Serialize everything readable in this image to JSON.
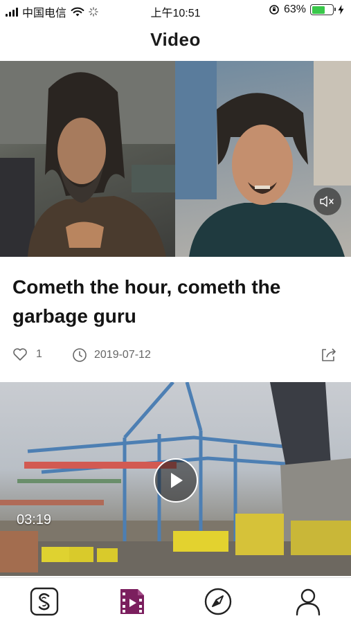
{
  "status_bar": {
    "carrier": "中国电信",
    "time": "上午10:51",
    "battery_percent": "63%",
    "battery_level": 0.63,
    "battery_color": "#39c84a"
  },
  "header": {
    "title": "Video"
  },
  "hero": {
    "headline": "Cometh the hour, cometh the garbage guru",
    "mute_icon": "speaker-muted-icon"
  },
  "meta": {
    "like_icon": "heart-icon",
    "like_count": "1",
    "date_icon": "clock-icon",
    "date": "2019-07-12",
    "share_icon": "share-icon"
  },
  "second_card": {
    "duration": "03:19",
    "play_icon": "play-icon"
  },
  "tab_bar": {
    "active_color": "#7b1f5e",
    "tabs": [
      {
        "icon": "brand-s-icon"
      },
      {
        "icon": "video-icon",
        "active": true
      },
      {
        "icon": "compass-icon"
      },
      {
        "icon": "profile-icon"
      }
    ]
  }
}
